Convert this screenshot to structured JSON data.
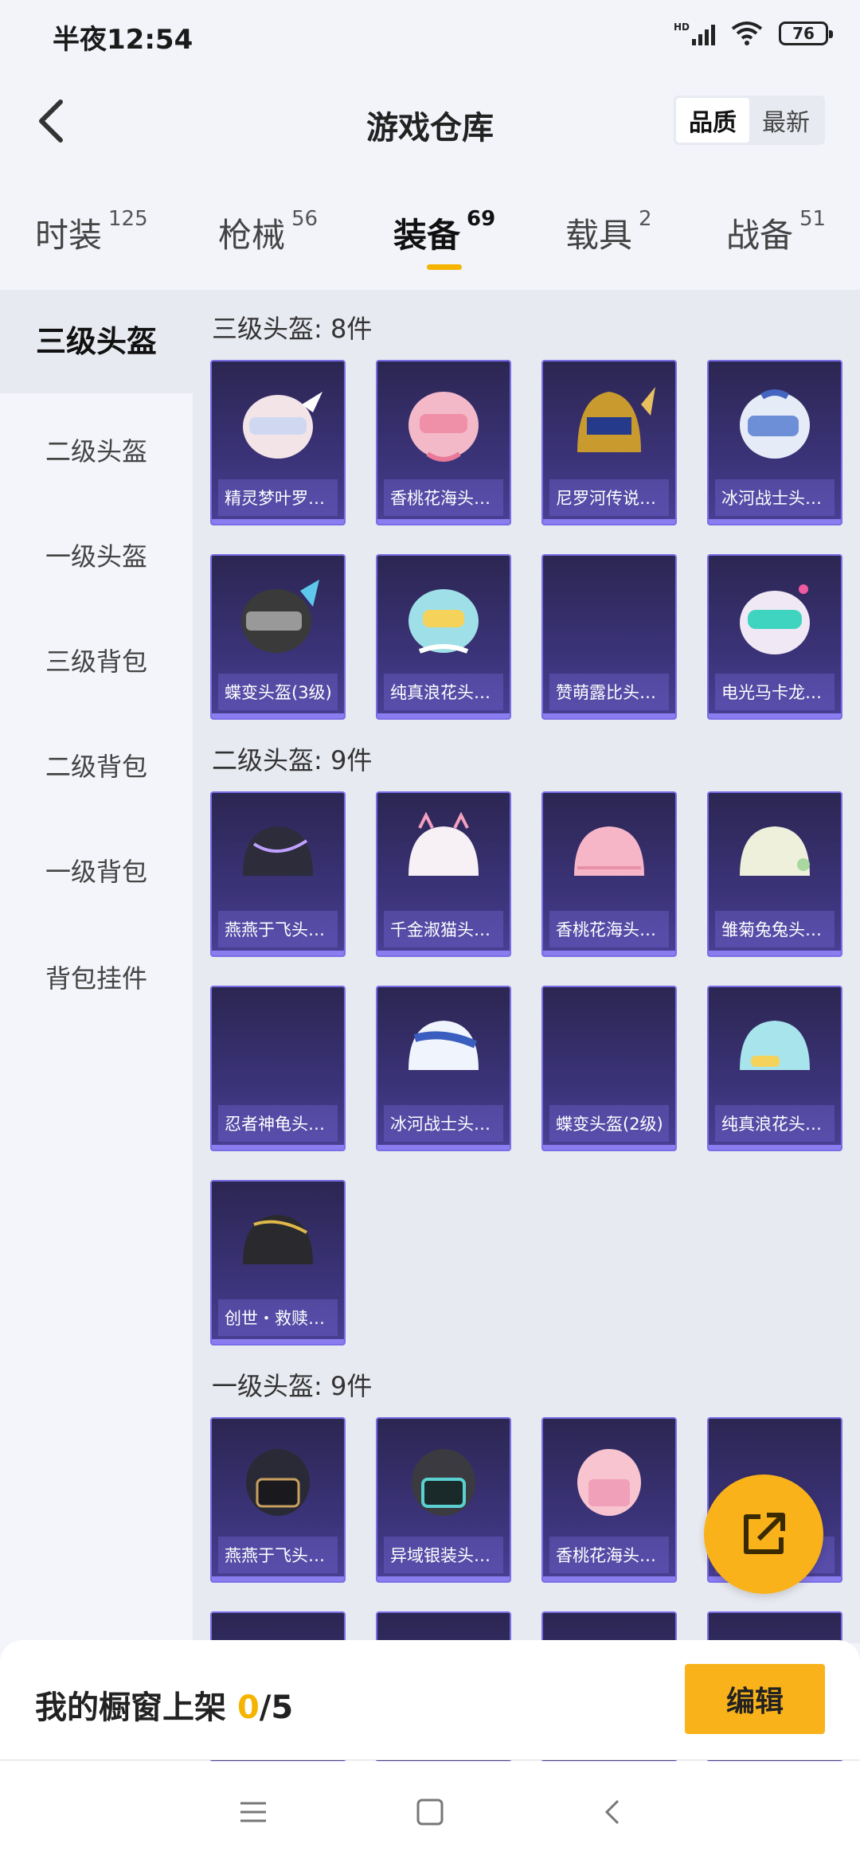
{
  "status_bar": {
    "time": "半夜12:54",
    "battery": "76",
    "network": "HD"
  },
  "header": {
    "title": "游戏仓库",
    "sort": [
      "品质",
      "最新"
    ]
  },
  "tabs": [
    {
      "label": "时装",
      "count": "125"
    },
    {
      "label": "枪械",
      "count": "56"
    },
    {
      "label": "装备",
      "count": "69"
    },
    {
      "label": "载具",
      "count": "2"
    },
    {
      "label": "战备",
      "count": "51"
    }
  ],
  "sidebar": [
    "三级头盔",
    "二级头盔",
    "一级头盔",
    "三级背包",
    "二级背包",
    "一级背包",
    "背包挂件"
  ],
  "sections": [
    {
      "title": "三级头盔: 8件",
      "items": [
        "精灵梦叶罗…",
        "香桃花海头…",
        "尼罗河传说…",
        "冰河战士头…",
        "蝶变头盔(3级)",
        "纯真浪花头…",
        "赞萌露比头…",
        "电光马卡龙…"
      ]
    },
    {
      "title": "二级头盔: 9件",
      "items": [
        "燕燕于飞头…",
        "千金淑猫头…",
        "香桃花海头…",
        "雏菊兔兔头…",
        "忍者神龟头…",
        "冰河战士头…",
        "蝶变头盔(2级)",
        "纯真浪花头…",
        "创世・救赎…"
      ]
    },
    {
      "title": "一级头盔: 9件",
      "items": [
        "燕燕于飞头…",
        "异域银装头…",
        "香桃花海头…",
        ""
      ]
    }
  ],
  "bottom": {
    "window_label": "我的橱窗上架 ",
    "current": "0",
    "total": "/5",
    "edit": "编辑"
  },
  "colors": {
    "accent": "#f9b21a",
    "card_border": "#7a6ee6",
    "card_bg": "#3b3378"
  }
}
